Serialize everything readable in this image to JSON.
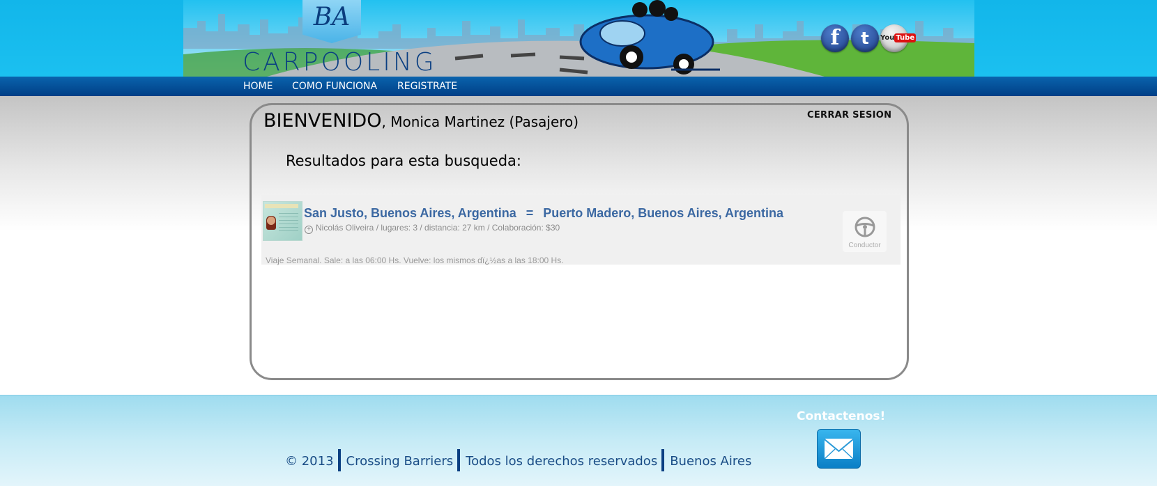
{
  "header": {
    "logo_initials": "BA",
    "logo_word": "CARPOOLING",
    "social": [
      {
        "name": "facebook",
        "glyph": "f"
      },
      {
        "name": "twitter",
        "glyph": "t"
      },
      {
        "name": "youtube",
        "glyph_you": "You",
        "glyph_tube": "Tube"
      }
    ]
  },
  "nav": {
    "items": [
      "HOME",
      "COMO FUNCIONA",
      "REGISTRATE"
    ]
  },
  "panel": {
    "welcome_label": "BIENVENIDO",
    "welcome_user": ", Monica Martinez (Pasajero)",
    "logout_label": "CERRAR SESION",
    "results_title": "Resultados para esta busqueda:"
  },
  "trip": {
    "origin": "San Justo, Buenos Aires, Argentina",
    "arrow": "=",
    "destination": "Puerto Madero, Buenos Aires, Argentina",
    "info": "Nicolás Oliveira / lugares: 3 / distancia: 27 km / Colaboración: $30",
    "description": "Viaje Semanal. Sale: a las 06:00 Hs. Vuelve: los mismos dï¿½as a las 18:00 Hs.",
    "role_badge": "Conductor",
    "icons": {
      "plus": "plus-circle-icon",
      "role": "steering-wheel-icon"
    }
  },
  "footer": {
    "contact_title": "Contactenos!",
    "copyright_symbol": "©",
    "year": "2013",
    "company": "Crossing Barriers",
    "rights": "Todos los derechos reservados",
    "city": "Buenos Aires"
  },
  "colors": {
    "nav_bg": "#0a63ad",
    "link": "#3b68a2",
    "footer_text": "#1a4d86",
    "sky": "#12b6ea"
  }
}
